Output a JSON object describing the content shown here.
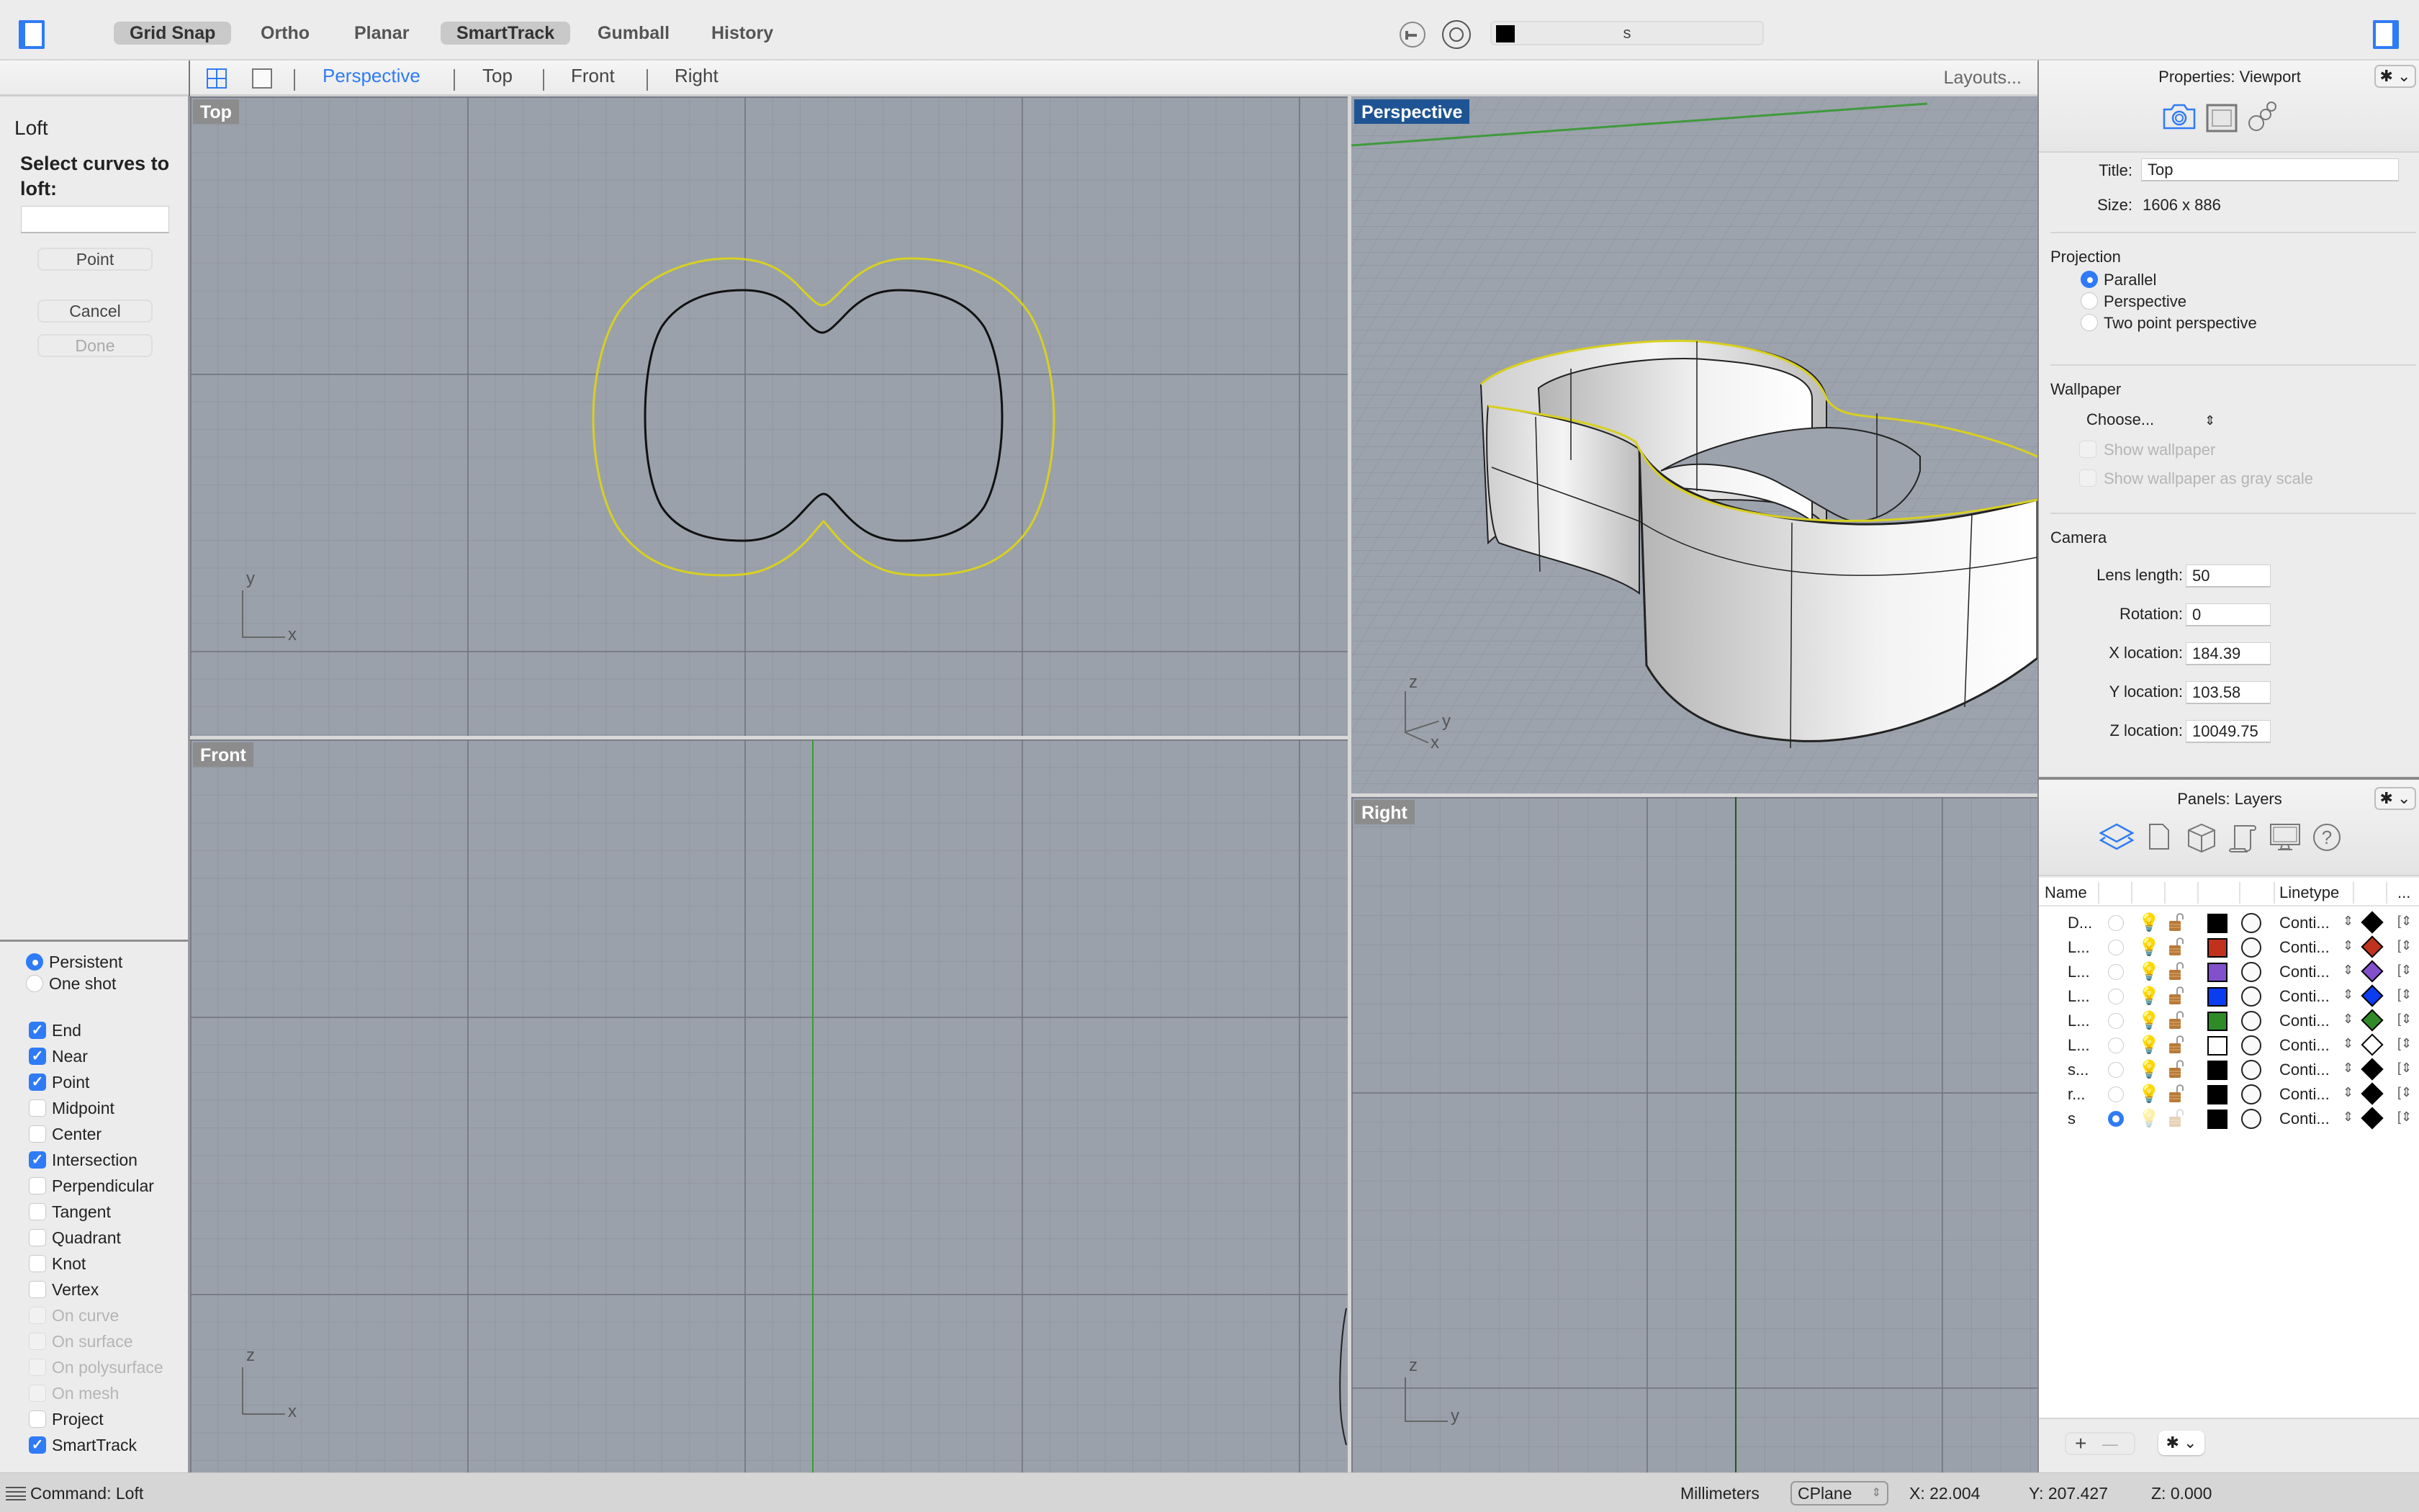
{
  "toolbar": {
    "modes": [
      {
        "label": "Grid Snap",
        "on": true
      },
      {
        "label": "Ortho",
        "on": false
      },
      {
        "label": "Planar",
        "on": false
      },
      {
        "label": "SmartTrack",
        "on": true
      },
      {
        "label": "Gumball",
        "on": false
      },
      {
        "label": "History",
        "on": false
      }
    ],
    "current_layer": "s",
    "current_layer_color": "#000000",
    "icons": [
      "sidebar-left-icon",
      "osnap-icon",
      "record-icon",
      "sidebar-right-icon"
    ]
  },
  "tabs": {
    "items": [
      {
        "label": "Perspective",
        "active": true
      },
      {
        "label": "Top",
        "active": false
      },
      {
        "label": "Front",
        "active": false
      },
      {
        "label": "Right",
        "active": false
      }
    ],
    "layouts": "Layouts..."
  },
  "command": {
    "title": "Loft",
    "prompt": "Select curves to loft:",
    "input_value": "",
    "point_label": "Point",
    "cancel_label": "Cancel",
    "done_label": "Done"
  },
  "osnap": {
    "mode_options": [
      {
        "label": "Persistent",
        "selected": true
      },
      {
        "label": "One shot",
        "selected": false
      }
    ],
    "snaps": [
      {
        "label": "End",
        "checked": true,
        "enabled": true
      },
      {
        "label": "Near",
        "checked": true,
        "enabled": true
      },
      {
        "label": "Point",
        "checked": true,
        "enabled": true
      },
      {
        "label": "Midpoint",
        "checked": false,
        "enabled": true
      },
      {
        "label": "Center",
        "checked": false,
        "enabled": true
      },
      {
        "label": "Intersection",
        "checked": true,
        "enabled": true
      },
      {
        "label": "Perpendicular",
        "checked": false,
        "enabled": true
      },
      {
        "label": "Tangent",
        "checked": false,
        "enabled": true
      },
      {
        "label": "Quadrant",
        "checked": false,
        "enabled": true
      },
      {
        "label": "Knot",
        "checked": false,
        "enabled": true
      },
      {
        "label": "Vertex",
        "checked": false,
        "enabled": true
      },
      {
        "label": "On curve",
        "checked": false,
        "enabled": false
      },
      {
        "label": "On surface",
        "checked": false,
        "enabled": false
      },
      {
        "label": "On polysurface",
        "checked": false,
        "enabled": false
      },
      {
        "label": "On mesh",
        "checked": false,
        "enabled": false
      },
      {
        "label": "Project",
        "checked": false,
        "enabled": true
      },
      {
        "label": "SmartTrack",
        "checked": true,
        "enabled": true
      }
    ]
  },
  "viewports": {
    "top": {
      "label": "Top",
      "axis_h": "x",
      "axis_v": "y"
    },
    "front": {
      "label": "Front",
      "axis_h": "x",
      "axis_v": "z"
    },
    "perspective": {
      "label": "Perspective",
      "axis_x": "x",
      "axis_y": "y",
      "axis_z": "z"
    },
    "right": {
      "label": "Right",
      "axis_h": "y",
      "axis_v": "z"
    }
  },
  "properties": {
    "title": "Properties: Viewport",
    "gear": "✱",
    "view_title_label": "Title:",
    "view_title_value": "Top",
    "size_label": "Size:",
    "size_value": "1606 x 886",
    "projection": {
      "heading": "Projection",
      "options": [
        {
          "label": "Parallel",
          "selected": true
        },
        {
          "label": "Perspective",
          "selected": false
        },
        {
          "label": "Two point perspective",
          "selected": false
        }
      ]
    },
    "wallpaper": {
      "heading": "Wallpaper",
      "choose": "Choose...",
      "show": "Show wallpaper",
      "grayscale": "Show wallpaper as gray scale"
    },
    "camera": {
      "heading": "Camera",
      "fields": [
        {
          "label": "Lens length:",
          "value": "50"
        },
        {
          "label": "Rotation:",
          "value": "0"
        },
        {
          "label": "X location:",
          "value": "184.39"
        },
        {
          "label": "Y location:",
          "value": "103.58"
        },
        {
          "label": "Z location:",
          "value": "10049.75"
        }
      ]
    }
  },
  "layers": {
    "title": "Panels: Layers",
    "columns": {
      "name": "Name",
      "linetype": "Linetype",
      "more": "..."
    },
    "rows": [
      {
        "name": "D...",
        "current": false,
        "color": "#000000",
        "linetype": "Conti...",
        "print_color": "#000000",
        "dim": false
      },
      {
        "name": "L...",
        "current": false,
        "color": "#c0321e",
        "linetype": "Conti...",
        "print_color": "#c0321e",
        "dim": false
      },
      {
        "name": "L...",
        "current": false,
        "color": "#8250cc",
        "linetype": "Conti...",
        "print_color": "#8250cc",
        "dim": false
      },
      {
        "name": "L...",
        "current": false,
        "color": "#0a3cf0",
        "linetype": "Conti...",
        "print_color": "#0a3cf0",
        "dim": false
      },
      {
        "name": "L...",
        "current": false,
        "color": "#2f8a28",
        "linetype": "Conti...",
        "print_color": "#2f8a28",
        "dim": false
      },
      {
        "name": "L...",
        "current": false,
        "color": "#ffffff",
        "linetype": "Conti...",
        "print_color": "#ffffff",
        "dim": false
      },
      {
        "name": "s...",
        "current": false,
        "color": "#000000",
        "linetype": "Conti...",
        "print_color": "#000000",
        "dim": false
      },
      {
        "name": "r...",
        "current": false,
        "color": "#000000",
        "linetype": "Conti...",
        "print_color": "#000000",
        "dim": false
      },
      {
        "name": "s",
        "current": true,
        "color": "#000000",
        "linetype": "Conti...",
        "print_color": "#000000",
        "dim": true
      }
    ],
    "add": "+",
    "remove": "—",
    "gear": "✱ ⌄"
  },
  "status": {
    "command": "Command: Loft",
    "units": "Millimeters",
    "cplane": "CPlane",
    "x": "X: 22.004",
    "y": "Y: 207.427",
    "z": "Z: 0.000"
  },
  "colors": {
    "accent": "#2f7bf5",
    "viewport_bg": "#9aa1ab",
    "active_viewport_label": "#1e5493",
    "selected_curve": "#d8d020"
  }
}
